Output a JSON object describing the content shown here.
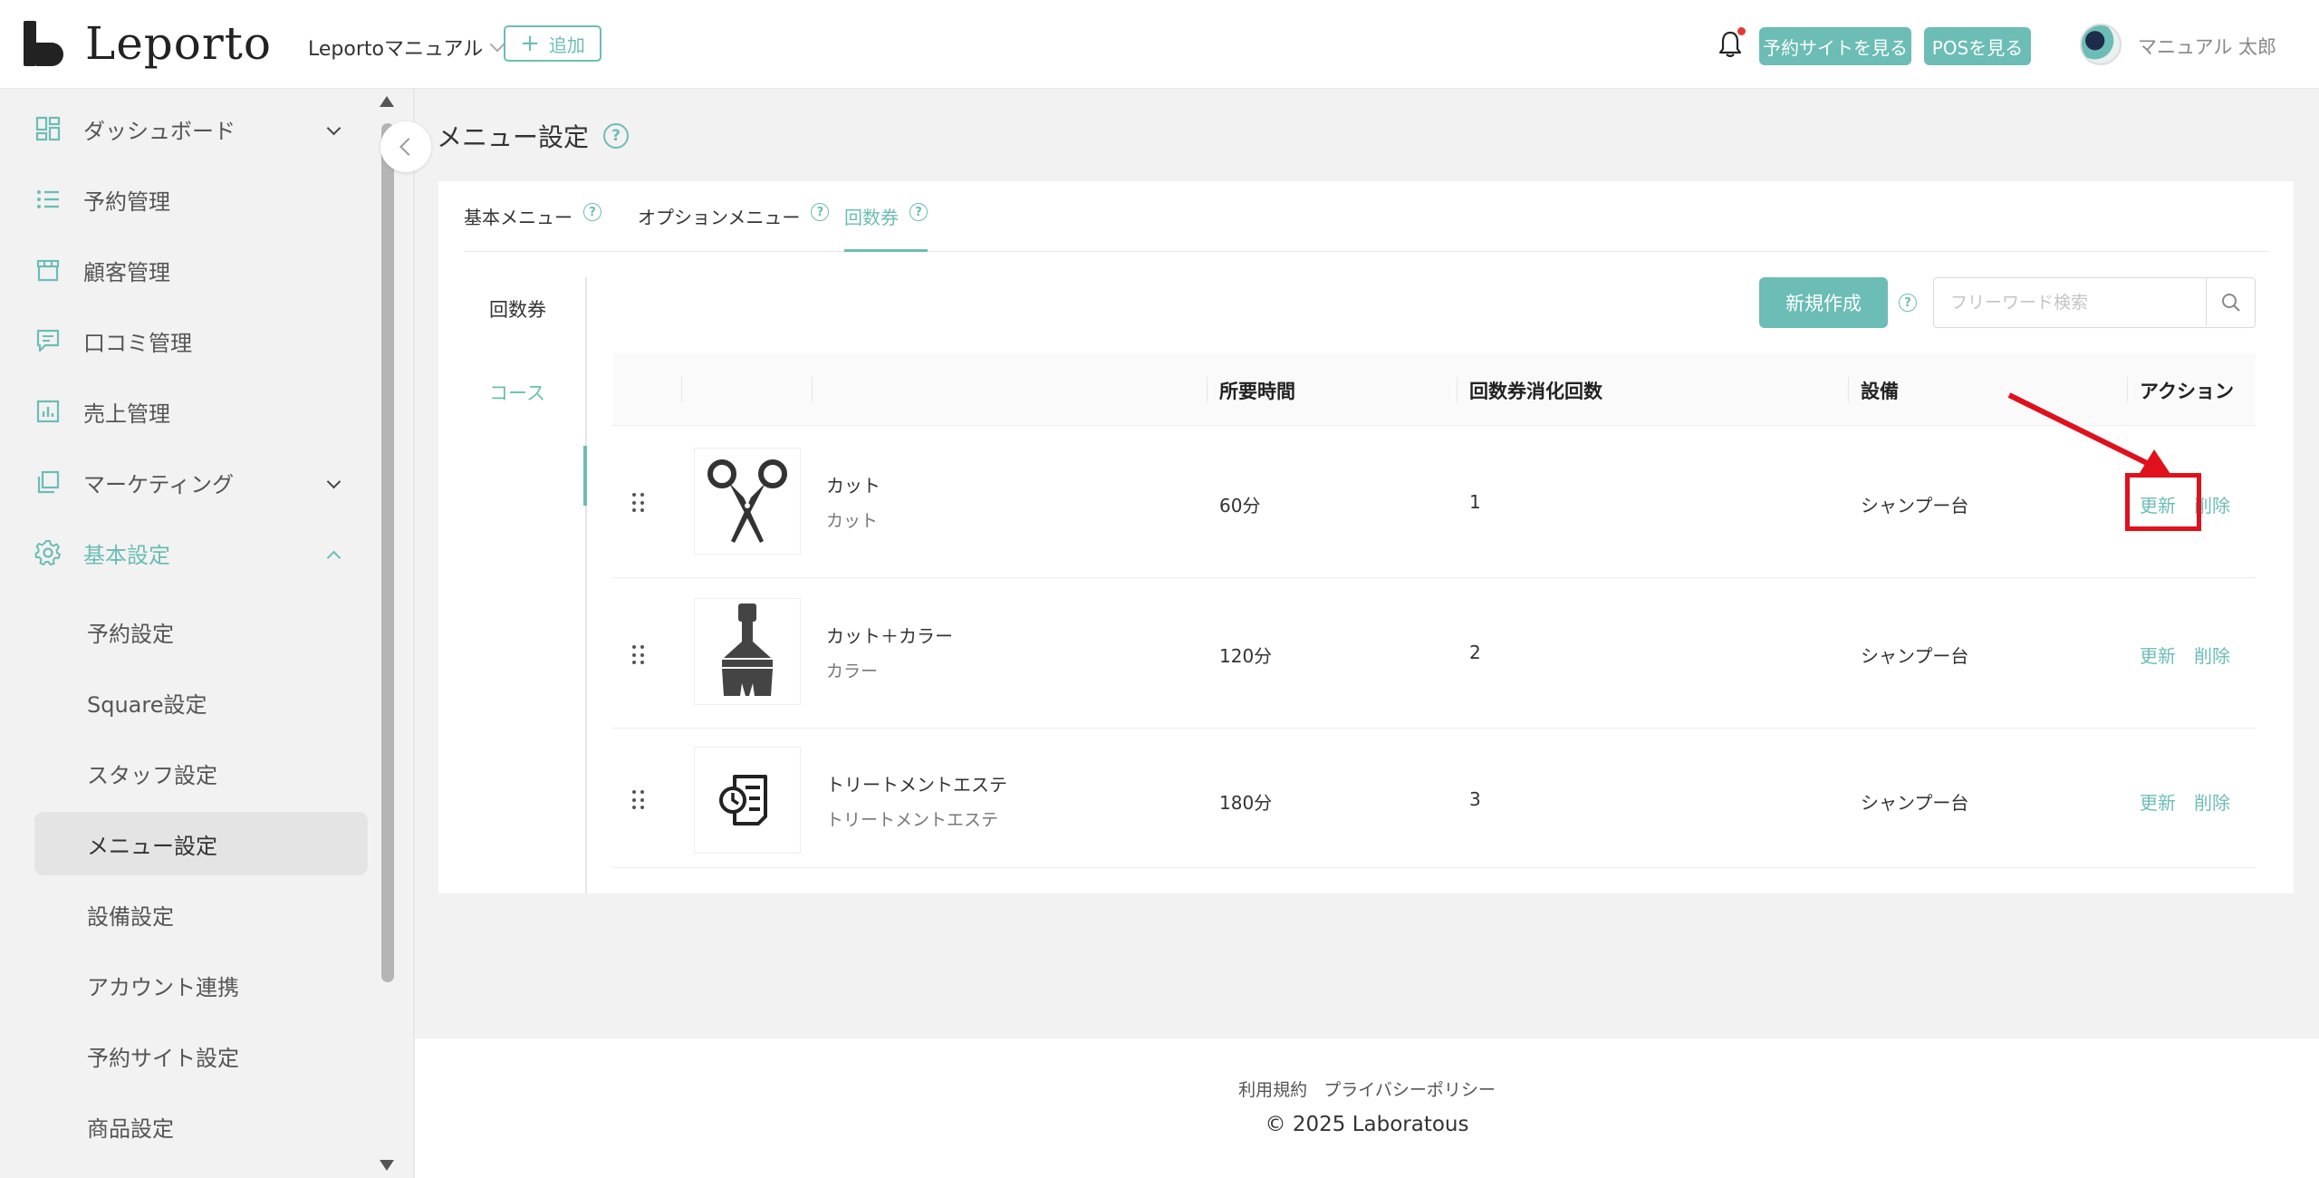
{
  "header": {
    "logo_text": "Leporto",
    "store_name": "Leportoマニュアル",
    "add_label": "追加",
    "booking_site_label": "予約サイトを見る",
    "pos_label": "POSを見る",
    "user_name": "マニュアル 太郎"
  },
  "sidebar": {
    "items": [
      {
        "label": "ダッシュボード",
        "icon": "dashboard-icon",
        "expandable": true
      },
      {
        "label": "予約管理",
        "icon": "list-icon"
      },
      {
        "label": "顧客管理",
        "icon": "store-icon"
      },
      {
        "label": "口コミ管理",
        "icon": "comment-icon"
      },
      {
        "label": "売上管理",
        "icon": "chart-icon"
      },
      {
        "label": "マーケティング",
        "icon": "layers-icon",
        "expandable": true
      },
      {
        "label": "基本設定",
        "icon": "gear-icon",
        "expanded": true
      }
    ],
    "sub_items": [
      "予約設定",
      "Square設定",
      "スタッフ設定",
      "メニュー設定",
      "設備設定",
      "アカウント連携",
      "予約サイト設定",
      "商品設定"
    ],
    "selected_sub": "メニュー設定"
  },
  "page": {
    "title": "メニュー設定",
    "tabs": [
      "基本メニュー",
      "オプションメニュー",
      "回数券"
    ],
    "active_tab": "回数券",
    "side_tabs": [
      "回数券",
      "コース"
    ],
    "active_side_tab": "コース",
    "new_button": "新規作成",
    "search_placeholder": "フリーワード検索"
  },
  "table": {
    "headers": [
      "所要時間",
      "回数券消化回数",
      "設備",
      "アクション"
    ],
    "rows": [
      {
        "name": "カット",
        "category": "カット",
        "duration": "60分",
        "count": "1",
        "equipment": "シャンプー台",
        "image": "scissors-icon",
        "update": "更新",
        "delete": "削除"
      },
      {
        "name": "カット＋カラー",
        "category": "カラー",
        "duration": "120分",
        "count": "2",
        "equipment": "シャンプー台",
        "image": "brush-icon",
        "update": "更新",
        "delete": "削除"
      },
      {
        "name": "トリートメントエステ",
        "category": "トリートメントエステ",
        "duration": "180分",
        "count": "3",
        "equipment": "シャンプー台",
        "image": "schedule-doc-icon",
        "update": "更新",
        "delete": "削除"
      }
    ]
  },
  "footer": {
    "terms": "利用規約",
    "privacy": "プライバシーポリシー",
    "copyright": "2025 Laboratous"
  },
  "colors": {
    "accent": "#6bbdb5",
    "highlight": "#e0101c",
    "notification": "#e53935"
  }
}
